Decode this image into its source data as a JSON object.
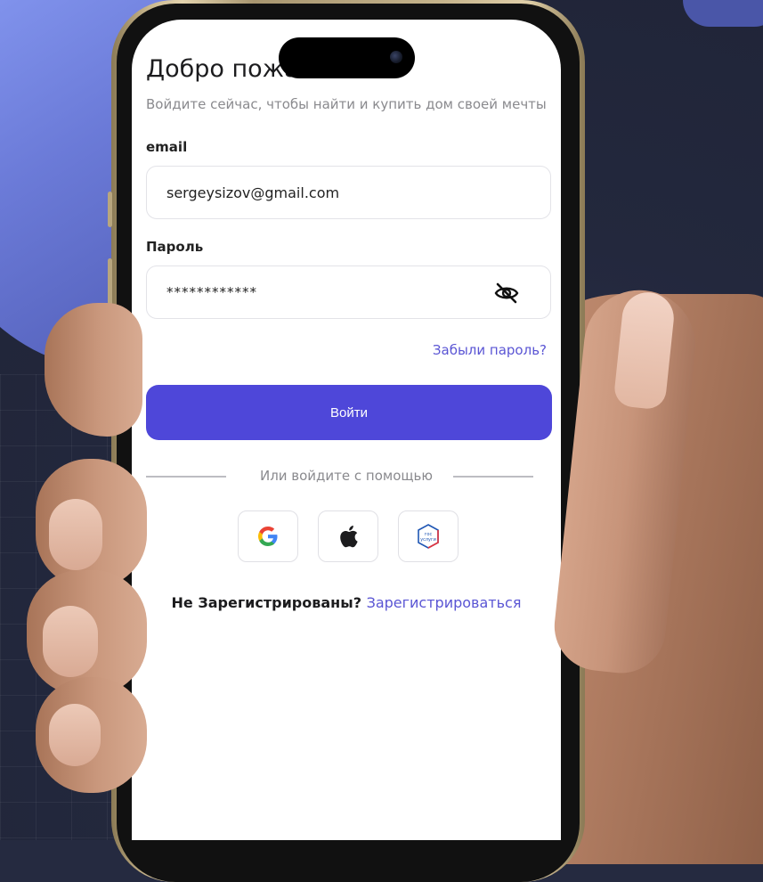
{
  "screen": {
    "title": "Добро пожаловать",
    "subtitle": "Войдите сейчас, чтобы найти и купить дом своей мечты"
  },
  "form": {
    "email_label": "email",
    "email_value": "sergeysizov@gmail.com",
    "password_label": "Пароль",
    "password_value": "************",
    "forgot_label": "Забыли пароль?",
    "login_label": "Войти"
  },
  "social": {
    "divider_text": "Или войдите с помощью",
    "gosuslugi_text": "гос услуги"
  },
  "register": {
    "prompt": "Не Зарегистрированы?",
    "link": "Зарегистрироваться"
  },
  "colors": {
    "accent": "#4e47d9",
    "link": "#5a55d4",
    "background": "#252a40",
    "blob": "#7b8cf0"
  },
  "icons": [
    "eye-off-icon",
    "google-icon",
    "apple-icon",
    "gosuslugi-icon"
  ]
}
